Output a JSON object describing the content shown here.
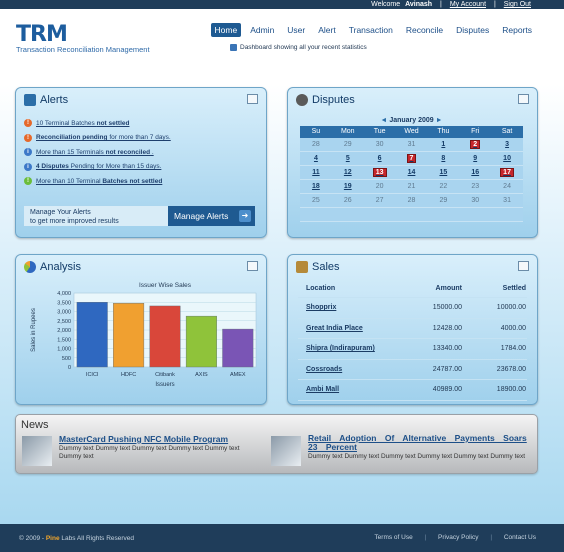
{
  "topbar": {
    "welcome_prefix": "Welcome",
    "user": "Avinash",
    "my_account": "My Account",
    "sign_out": "Sign Out",
    "separator": "|"
  },
  "header": {
    "logo": "TRM",
    "tagline": "Transaction Reconciliation Management",
    "nav": [
      "Home",
      "Admin",
      "User",
      "Alert",
      "Transaction",
      "Reconcile",
      "Disputes",
      "Reports"
    ],
    "active_nav": "Home",
    "subnav_text": "Dashboard showing all your recent statistics"
  },
  "alerts": {
    "title": "Alerts",
    "items": [
      {
        "pre": "10 Terminal Batches ",
        "bold": "not settled",
        "post": "",
        "type": "error",
        "color": "#e5692b"
      },
      {
        "pre": "",
        "bold": "Reconciliation pending",
        "post": " for more than 7 days.",
        "type": "error",
        "color": "#e5692b"
      },
      {
        "pre": "More than 15 Terminals ",
        "bold": "not reconciled",
        "post": " .",
        "type": "info",
        "color": "#3c78c8"
      },
      {
        "pre": "",
        "bold": "4 Disputes",
        "post": " Pending for More than 15 days.",
        "type": "info",
        "color": "#3c78c8"
      },
      {
        "pre": "More than 10 Terminal ",
        "bold": "Batches not settled",
        "post": "",
        "type": "ok",
        "color": "#6bbd3b"
      }
    ],
    "manage_text_1": "Manage Your Alerts",
    "manage_text_2": "to get more improved results",
    "manage_button": "Manage Alerts",
    "arrow": "➜"
  },
  "disputes": {
    "title": "Disputes",
    "month": "January 2009",
    "prev": "◄",
    "next": "►",
    "days_of_week": [
      "Su",
      "Mon",
      "Tue",
      "Wed",
      "Thu",
      "Fri",
      "Sat"
    ],
    "cells": [
      {
        "t": "28",
        "s": "muted"
      },
      {
        "t": "29",
        "s": "muted"
      },
      {
        "t": "30",
        "s": "muted"
      },
      {
        "t": "31",
        "s": "muted"
      },
      {
        "t": "1",
        "s": "link"
      },
      {
        "t": "2",
        "s": "highlight"
      },
      {
        "t": "3",
        "s": "link"
      },
      {
        "t": "4",
        "s": "link"
      },
      {
        "t": "5",
        "s": "link"
      },
      {
        "t": "6",
        "s": "link"
      },
      {
        "t": "7",
        "s": "highlight"
      },
      {
        "t": "8",
        "s": "link"
      },
      {
        "t": "9",
        "s": "link"
      },
      {
        "t": "10",
        "s": "link"
      },
      {
        "t": "11",
        "s": "link"
      },
      {
        "t": "12",
        "s": "link"
      },
      {
        "t": "13",
        "s": "highlight"
      },
      {
        "t": "14",
        "s": "link"
      },
      {
        "t": "15",
        "s": "link"
      },
      {
        "t": "16",
        "s": "link"
      },
      {
        "t": "17",
        "s": "highlight"
      },
      {
        "t": "18",
        "s": "link"
      },
      {
        "t": "19",
        "s": "link"
      },
      {
        "t": "20",
        "s": "muted"
      },
      {
        "t": "21",
        "s": "muted"
      },
      {
        "t": "22",
        "s": "muted"
      },
      {
        "t": "23",
        "s": "muted"
      },
      {
        "t": "24",
        "s": "muted"
      },
      {
        "t": "25",
        "s": "muted"
      },
      {
        "t": "26",
        "s": "muted"
      },
      {
        "t": "27",
        "s": "muted"
      },
      {
        "t": "28",
        "s": "muted"
      },
      {
        "t": "29",
        "s": "muted"
      },
      {
        "t": "30",
        "s": "muted"
      },
      {
        "t": "31",
        "s": "muted"
      },
      {
        "t": "",
        "s": "muted"
      },
      {
        "t": "",
        "s": "muted"
      },
      {
        "t": "",
        "s": "muted"
      },
      {
        "t": "",
        "s": "muted"
      },
      {
        "t": "",
        "s": "muted"
      },
      {
        "t": "",
        "s": "muted"
      },
      {
        "t": "",
        "s": "muted"
      }
    ]
  },
  "analysis": {
    "title": "Analysis"
  },
  "chart_data": {
    "type": "bar",
    "title": "Issuer Wise Sales",
    "xlabel": "Issuers",
    "ylabel": "Sales in Rupees",
    "categories": [
      "ICICI",
      "HDFC",
      "Citibank",
      "AXIS",
      "AMEX"
    ],
    "values": [
      3500,
      3450,
      3300,
      2750,
      2050
    ],
    "colors": [
      "#2f68c0",
      "#f0a030",
      "#d9473a",
      "#8fc33a",
      "#7a55b5"
    ],
    "ylim": [
      0,
      4000
    ],
    "yticks": [
      "0",
      "500",
      "1,000",
      "1,500",
      "2,000",
      "2,500",
      "3,000",
      "3,500",
      "4,000"
    ],
    "grid": true
  },
  "sales": {
    "title": "Sales",
    "columns": [
      "Location",
      "Amount",
      "Settled"
    ],
    "rows": [
      [
        "Shopprix",
        "15000.00",
        "10000.00"
      ],
      [
        "Great India Place",
        "12428.00",
        "4000.00"
      ],
      [
        "Shipra (Indirapuram)",
        "13340.00",
        "1784.00"
      ],
      [
        "Cossroads",
        "24787.00",
        "23678.00"
      ],
      [
        "Ambi Mall",
        "40989.00",
        "18900.00"
      ]
    ]
  },
  "news": {
    "title": "News",
    "items": [
      {
        "headline": "MasterCard Pushing NFC Mobile Program",
        "body": "Dummy text Dummy text Dummy text Dummy text Dummy text Dummy text"
      },
      {
        "headline": "Retail Adoption Of Alternative Payments Soars 23 Percent",
        "body": "Dummy text Dummy text Dummy text Dummy text Dummy text Dummy text"
      }
    ]
  },
  "footer": {
    "copyright_prefix": "© 2009 -",
    "brand": "Pine",
    "copyright_suffix": "Labs All Rights Reserved",
    "links": [
      "Terms of Use",
      "Privacy Policy",
      "Contact Us"
    ],
    "separator": "|"
  }
}
